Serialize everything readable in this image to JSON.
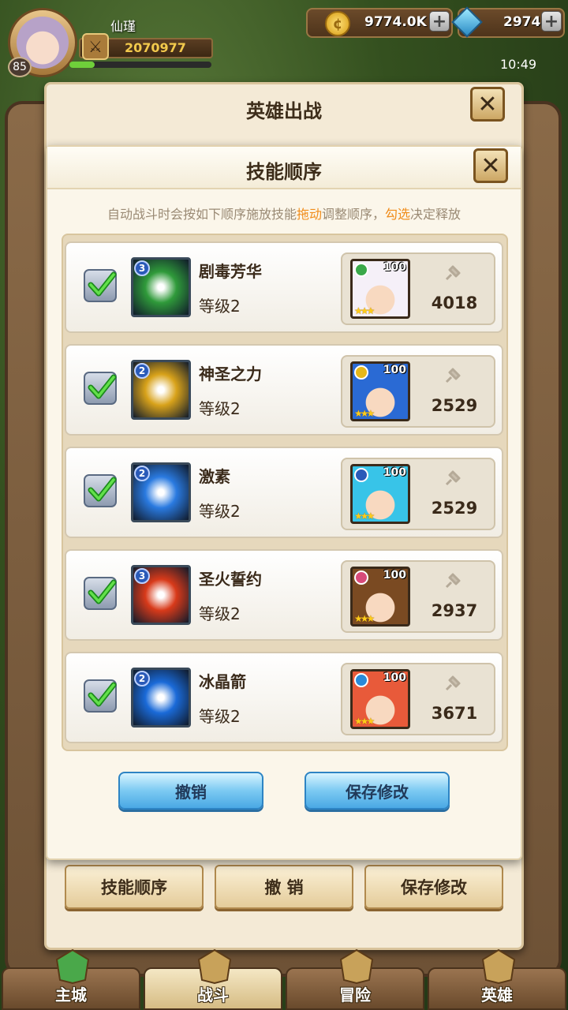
{
  "player": {
    "name": "仙瑾",
    "level": "85",
    "power": "2070977",
    "xp_fraction": 0.18
  },
  "resources": {
    "coins": "9774.0K",
    "gems": "2974"
  },
  "clock": "10:49",
  "outer_dialog": {
    "title": "英雄出战",
    "buttons": [
      "技能顺序",
      "撤 销",
      "保存修改"
    ]
  },
  "skill_dialog": {
    "title": "技能顺序",
    "hint": {
      "part1": "自动战斗时会按如下顺序施放技能",
      "drag": "拖动",
      "part2": "调整顺序，",
      "check": "勾选",
      "part3": "决定释放"
    },
    "rows": [
      {
        "checked": true,
        "skill_tier": "3",
        "skill_name": "剧毒芳华",
        "skill_level": "等级2",
        "skill_color": "#2f9a3a",
        "hero_level": "100",
        "hero_type_color": "#3aa84a",
        "hero_hair": "#f5f0f8",
        "hero_power": "4018"
      },
      {
        "checked": true,
        "skill_tier": "2",
        "skill_name": "神圣之力",
        "skill_level": "等级2",
        "skill_color": "#d8a21a",
        "hero_level": "100",
        "hero_type_color": "#e6b81a",
        "hero_hair": "#2a6ad4",
        "hero_power": "2529"
      },
      {
        "checked": true,
        "skill_tier": "2",
        "skill_name": "激素",
        "skill_level": "等级2",
        "skill_color": "#2a7ae0",
        "hero_level": "100",
        "hero_type_color": "#2a5ab8",
        "hero_hair": "#38c4e8",
        "hero_power": "2529"
      },
      {
        "checked": true,
        "skill_tier": "3",
        "skill_name": "圣火誓约",
        "skill_level": "等级2",
        "skill_color": "#d83a1a",
        "hero_level": "100",
        "hero_type_color": "#d84a7a",
        "hero_hair": "#7a4a22",
        "hero_power": "2937"
      },
      {
        "checked": true,
        "skill_tier": "2",
        "skill_name": "冰晶箭",
        "skill_level": "等级2",
        "skill_color": "#1a6ad8",
        "hero_level": "100",
        "hero_type_color": "#2a8ad8",
        "hero_hair": "#e85a3a",
        "hero_power": "3671"
      }
    ],
    "cancel_label": "撤销",
    "save_label": "保存修改"
  },
  "nav": [
    "主城",
    "战斗",
    "冒险",
    "英雄"
  ],
  "active_nav": 1
}
